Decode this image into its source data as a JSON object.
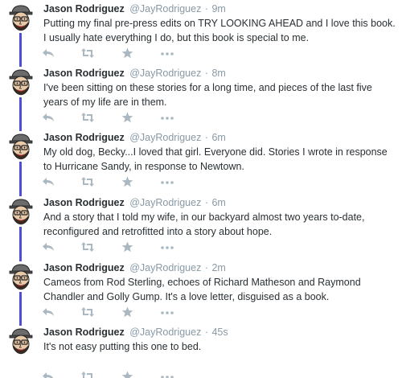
{
  "tweets": [
    {
      "name": "Jason Rodriguez",
      "handle": "@JayRodriguez",
      "time": "9m",
      "text": "Putting my final pre-press edits on TRY LOOKING AHEAD and I love this book. I usually hate everything I do, but this book is special to me."
    },
    {
      "name": "Jason Rodriguez",
      "handle": "@JayRodriguez",
      "time": "8m",
      "text": "I've been sitting on these stories for a long time, and pieces of the last five years of my life are in them."
    },
    {
      "name": "Jason Rodriguez",
      "handle": "@JayRodriguez",
      "time": "6m",
      "text": "My old dog, Becky...I loved that girl. Everyone did. Stories I wrote in response to Hurricane Sandy, in response to Newtown."
    },
    {
      "name": "Jason Rodriguez",
      "handle": "@JayRodriguez",
      "time": "6m",
      "text": "And a story that I told my wife, in our backyard almost two years to-date, reconfigured and retrofitted into a story about hope."
    },
    {
      "name": "Jason Rodriguez",
      "handle": "@JayRodriguez",
      "time": "2m",
      "text": "Cameos from Rod Sterling, echoes of Richard Matheson and Raymond Chandler and Golly Gump. It's a love letter, disguised as a book."
    },
    {
      "name": "Jason Rodriguez",
      "handle": "@JayRodriguez",
      "time": "45s",
      "text": "It's not easy putting this one to bed."
    }
  ],
  "separator": "·",
  "icons": {
    "reply": "reply-icon",
    "retweet": "retweet-icon",
    "favorite": "star-icon",
    "more": "more-icon"
  },
  "colors": {
    "thread_line": "#4e4ed6",
    "icon": "#aab8c2",
    "meta": "#8899a6"
  }
}
